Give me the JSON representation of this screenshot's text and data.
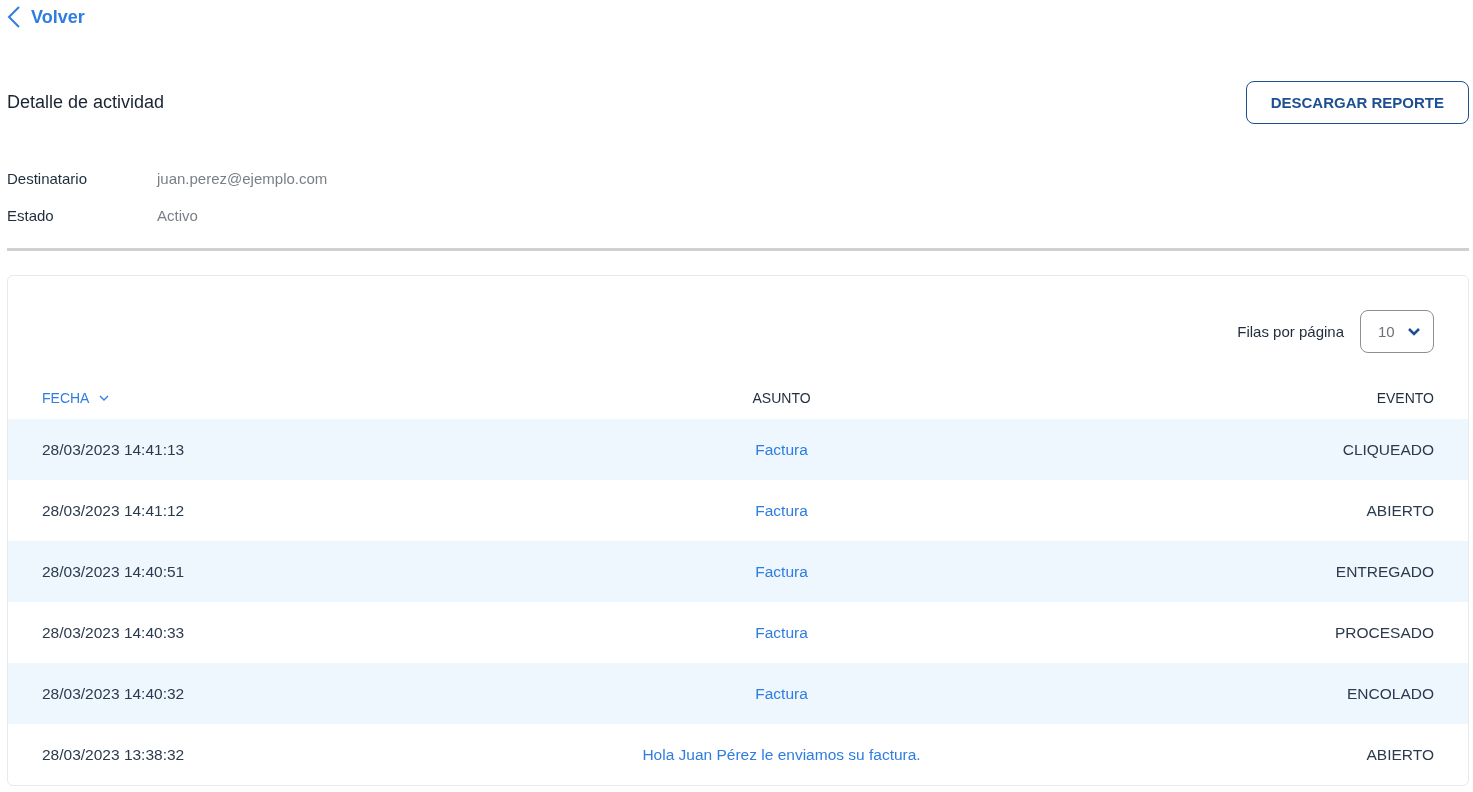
{
  "back_link": {
    "label": "Volver"
  },
  "title": "Detalle de actividad",
  "download_button": {
    "label": "DESCARGAR REPORTE"
  },
  "details": [
    {
      "label": "Destinatario",
      "value": "juan.perez@ejemplo.com"
    },
    {
      "label": "Estado",
      "value": "Activo"
    }
  ],
  "table": {
    "rows_per_page": {
      "label": "Filas por página",
      "value": "10"
    },
    "columns": [
      {
        "label": "FECHA",
        "sorted": true
      },
      {
        "label": "ASUNTO",
        "sorted": false
      },
      {
        "label": "EVENTO",
        "sorted": false
      }
    ],
    "rows": [
      {
        "date": "28/03/2023 14:41:13",
        "subject": "Factura",
        "event": "CLIQUEADO"
      },
      {
        "date": "28/03/2023 14:41:12",
        "subject": "Factura",
        "event": "ABIERTO"
      },
      {
        "date": "28/03/2023 14:40:51",
        "subject": "Factura",
        "event": "ENTREGADO"
      },
      {
        "date": "28/03/2023 14:40:33",
        "subject": "Factura",
        "event": "PROCESADO"
      },
      {
        "date": "28/03/2023 14:40:32",
        "subject": "Factura",
        "event": "ENCOLADO"
      },
      {
        "date": "28/03/2023 13:38:32",
        "subject": "Hola Juan Pérez le enviamos su factura.",
        "event": "ABIERTO"
      }
    ]
  }
}
